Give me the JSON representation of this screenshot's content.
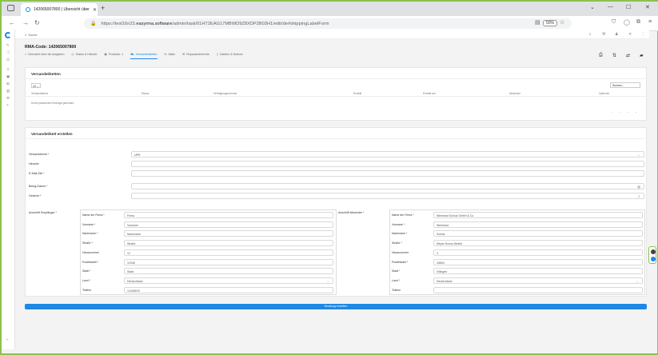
{
  "browser": {
    "tab_title": "142065007800 | Übersicht über",
    "url_prefix": "https://test16n23.",
    "url_domain": "easyrma.software",
    "url_path": "/admin/task/01HT2EAG17MBWD9Z8XDP2B03H1/edit/de#shippingLabelForm",
    "zoom": "50%"
  },
  "app": {
    "search_placeholder": "Suche",
    "title": "RMA-Code: 142065007800"
  },
  "tabs": [
    {
      "label": "Übersicht über die Aufgaben"
    },
    {
      "label": "Status & Historie"
    },
    {
      "label": "Produkte: 1"
    },
    {
      "label": "Versandetiketten",
      "active": true
    },
    {
      "label": "Mails"
    },
    {
      "label": "Reparaturberichte"
    },
    {
      "label": "Dateien & Notizen"
    }
  ],
  "labels_table": {
    "heading": "Versandetiketten",
    "length_value": "10",
    "search_placeholder": "Suchen...",
    "columns": [
      "Versanddienst",
      "Status",
      "Verfolgungsnummer",
      "Erstellt",
      "Erstellt am",
      "Absender",
      "Optionen"
    ],
    "empty": "Keine passenden Einträge gefunden",
    "pager": "‹ ‹ › ›"
  },
  "create_form": {
    "heading": "Versandetikett erstellen",
    "service_label": "Versanddienst *",
    "service_value": "UPS",
    "hint_label": "Hinweis",
    "ref_label": "E-Mail-Ziel *",
    "pickup_label": "Beleg-Datum *",
    "weight_label": "Gewicht *",
    "submit_label": "Sendung erstellen"
  },
  "recipient": {
    "group_label": "Anschrift Empfänger *",
    "fields": [
      {
        "label": "Name der Firma *",
        "value": "Firma"
      },
      {
        "label": "Vorname *",
        "value": "Vorname"
      },
      {
        "label": "Nachname *",
        "value": "Nachname"
      },
      {
        "label": "Straße *",
        "value": "Straße"
      },
      {
        "label": "Hausnummer",
        "value": "12"
      },
      {
        "label": "Postleitzahl *",
        "value": "12345"
      },
      {
        "label": "Stadt *",
        "value": "Stadt"
      },
      {
        "label": "Land *",
        "value": "Deutschland"
      },
      {
        "label": "Telefon",
        "value": "12345678"
      }
    ]
  },
  "sender": {
    "group_label": "Anschrift Absender *",
    "fields": [
      {
        "label": "Name der Firma *",
        "value": "Weinhard Scholz GmbH & Co"
      },
      {
        "label": "Vorname *",
        "value": "Weinhard"
      },
      {
        "label": "Nachname *",
        "value": "Scholz"
      },
      {
        "label": "Straße *",
        "value": "Meyer-Knoss-Straße"
      },
      {
        "label": "Hausnummer",
        "value": "4"
      },
      {
        "label": "Postleitzahl *",
        "value": "33604"
      },
      {
        "label": "Stadt *",
        "value": "Villingen"
      },
      {
        "label": "Land *",
        "value": "Deutschland"
      },
      {
        "label": "Telefon",
        "value": ""
      }
    ]
  }
}
